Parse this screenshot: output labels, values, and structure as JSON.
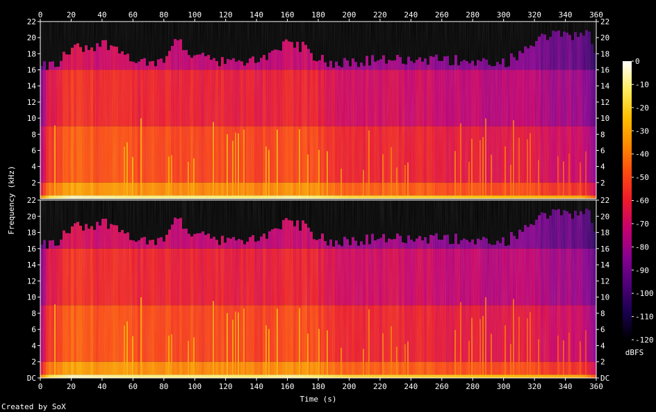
{
  "chart_data": {
    "type": "heatmap",
    "title": "",
    "xlabel": "Time (s)",
    "ylabel": "Frequency (kHz)",
    "x_ticks": [
      0,
      20,
      40,
      60,
      80,
      100,
      120,
      140,
      160,
      180,
      200,
      220,
      240,
      260,
      280,
      300,
      320,
      340,
      360
    ],
    "xlim": [
      0,
      360
    ],
    "y_ticks": [
      0,
      2,
      4,
      6,
      8,
      10,
      12,
      14,
      16,
      18,
      20,
      22
    ],
    "ylim": [
      0,
      22
    ],
    "y_ticks_top_label": "22",
    "y_ticks_bottom_label": "DC",
    "channels": 2,
    "cutoff_khz": 16,
    "colorbar": {
      "label": "dBFS",
      "ticks": [
        0,
        -10,
        -20,
        -30,
        -40,
        -50,
        -60,
        -70,
        -80,
        -90,
        -100,
        -110,
        -120
      ],
      "range": [
        -120,
        0
      ],
      "palette": [
        "#000000",
        "#1a0050",
        "#50007a",
        "#8a0090",
        "#c8006e",
        "#ee1a2a",
        "#ff4a10",
        "#ff8a00",
        "#ffc000",
        "#ffee60",
        "#ffffff"
      ]
    },
    "bursts_khz": [
      [
        0,
        16
      ],
      [
        10,
        16.5
      ],
      [
        20,
        18.5
      ],
      [
        30,
        18.5
      ],
      [
        40,
        19
      ],
      [
        50,
        18.5
      ],
      [
        60,
        17
      ],
      [
        70,
        16.5
      ],
      [
        80,
        17
      ],
      [
        88,
        20
      ],
      [
        95,
        17
      ],
      [
        105,
        17.5
      ],
      [
        120,
        16.5
      ],
      [
        140,
        17
      ],
      [
        150,
        18
      ],
      [
        160,
        19
      ],
      [
        170,
        18.5
      ],
      [
        180,
        17
      ],
      [
        190,
        16.5
      ],
      [
        220,
        17
      ],
      [
        260,
        17
      ],
      [
        300,
        16.5
      ],
      [
        325,
        20
      ],
      [
        340,
        20
      ],
      [
        355,
        20
      ],
      [
        360,
        16
      ]
    ],
    "intensity_dbfs": [
      [
        0,
        -75
      ],
      [
        5,
        -55
      ],
      [
        20,
        -45
      ],
      [
        40,
        -48
      ],
      [
        60,
        -50
      ],
      [
        80,
        -50
      ],
      [
        100,
        -50
      ],
      [
        140,
        -52
      ],
      [
        160,
        -48
      ],
      [
        180,
        -52
      ],
      [
        200,
        -58
      ],
      [
        240,
        -60
      ],
      [
        280,
        -63
      ],
      [
        320,
        -66
      ],
      [
        350,
        -70
      ],
      [
        360,
        -90
      ]
    ]
  },
  "footer": "Created by SoX"
}
